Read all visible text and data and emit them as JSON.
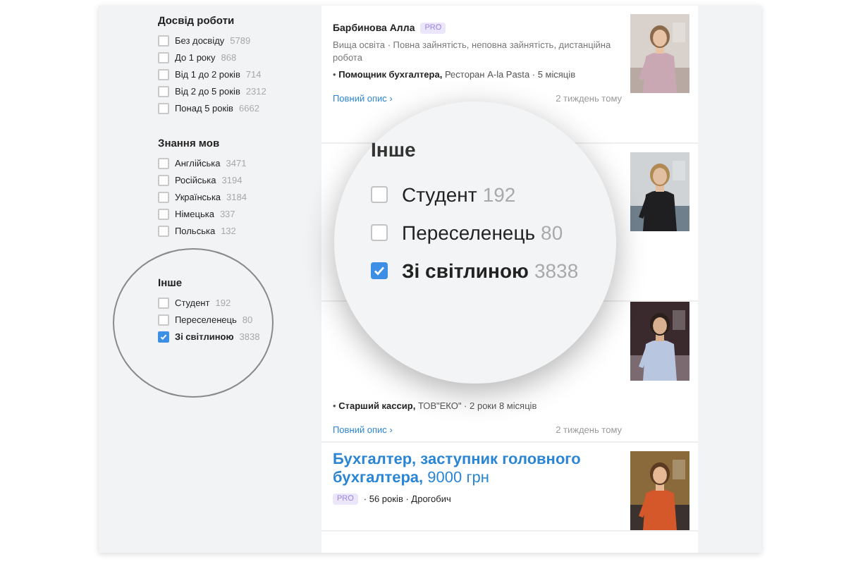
{
  "sidebar": {
    "sections": [
      {
        "title": "Досвід роботи",
        "items": [
          {
            "label": "Без досвіду",
            "count": "5789",
            "checked": false
          },
          {
            "label": "До 1 року",
            "count": "868",
            "checked": false
          },
          {
            "label": "Від 1 до 2 років",
            "count": "714",
            "checked": false
          },
          {
            "label": "Від 2 до 5 років",
            "count": "2312",
            "checked": false
          },
          {
            "label": "Понад 5 років",
            "count": "6662",
            "checked": false
          }
        ]
      },
      {
        "title": "Знання мов",
        "items": [
          {
            "label": "Англійська",
            "count": "3471",
            "checked": false
          },
          {
            "label": "Російська",
            "count": "3194",
            "checked": false
          },
          {
            "label": "Українська",
            "count": "3184",
            "checked": false
          },
          {
            "label": "Німецька",
            "count": "337",
            "checked": false
          },
          {
            "label": "Польська",
            "count": "132",
            "checked": false
          }
        ]
      },
      {
        "title": "Інше",
        "items": [
          {
            "label": "Студент",
            "count": "192",
            "checked": false
          },
          {
            "label": "Переселенець",
            "count": "80",
            "checked": false
          },
          {
            "label": "Зі світлиною",
            "count": "3838",
            "checked": true
          }
        ]
      }
    ]
  },
  "cards": [
    {
      "name": "Барбинова Алла",
      "badge": "PRO",
      "details": "Вища освіта · Повна зайнятість, неповна зайнятість, дистанційна робота",
      "jobs": [
        {
          "bullet": "•",
          "role": "Помощник бухгалтера,",
          "rest": "Ресторан A-la Pasta · 5 місяців"
        }
      ],
      "link": "Повний опис ›",
      "time": "2 тиждень тому",
      "photo": {
        "kind": "picture"
      }
    },
    {
      "photo": {
        "kind": "picture"
      }
    },
    {
      "jobs": [
        {
          "bullet": "•",
          "role": "Старший кассир,",
          "rest": "ТОВ\"ЕКО\" · 2 роки 8 місяців"
        }
      ],
      "link": "Повний опис ›",
      "time": "2 тиждень тому",
      "photo": {
        "kind": "picture"
      }
    },
    {
      "title": "**Бухгалтер, заступник головного бухгалтера,** 9000 грн",
      "badge": "PRO",
      "meta": "· 56 років · Дрогобич",
      "photo": {
        "kind": "picture"
      }
    }
  ],
  "magnifier": {
    "title": "Інше",
    "items": [
      {
        "label": "Студент",
        "count": "192",
        "checked": false
      },
      {
        "label": "Переселенець",
        "count": "80",
        "checked": false
      },
      {
        "label": "Зі світлиною",
        "count": "3838",
        "checked": true
      }
    ]
  }
}
